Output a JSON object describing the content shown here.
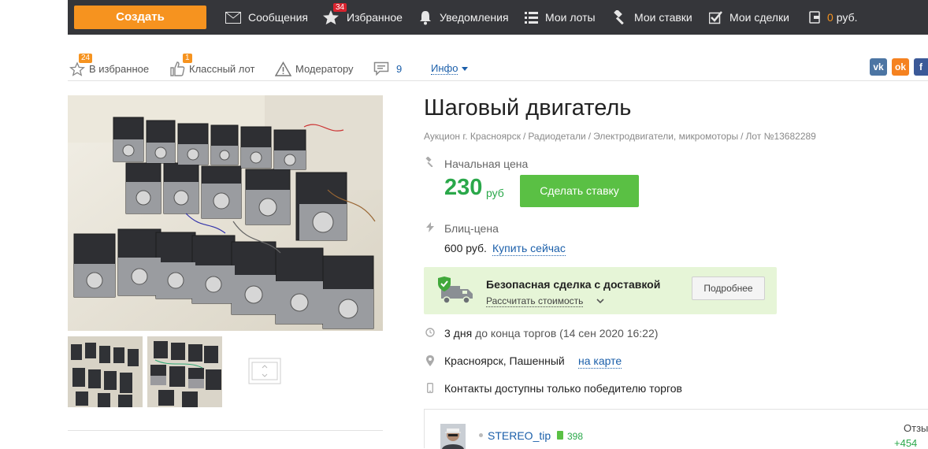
{
  "topbar": {
    "create_label": "Создать",
    "messages_label": "Сообщения",
    "favorites_label": "Избранное",
    "favorites_badge": "34",
    "notifications_label": "Уведомления",
    "my_lots_label": "Мои лоты",
    "my_bids_label": "Мои ставки",
    "my_deals_label": "Мои сделки",
    "balance_amount": "0",
    "balance_currency": "руб."
  },
  "actions": {
    "favorites_count": "24",
    "favorites_label": "В избранное",
    "like_count": "1",
    "like_label": "Классный лот",
    "moderator_label": "Модератору",
    "comments_count": "9",
    "info_label": "Инфо"
  },
  "share": {
    "vk": "vk",
    "ok": "ok",
    "fb": "f"
  },
  "lot": {
    "title": "Шаговый двигатель",
    "breadcrumbs": [
      "Аукцион г. Красноярск",
      "Радиодетали",
      "Электродвигатели, микромоторы",
      "Лот №13682289"
    ],
    "breadcrumb_sep": "/",
    "start_price_label": "Начальная цена",
    "start_price": "230",
    "currency": "руб",
    "bid_button": "Сделать ставку",
    "blitz_label": "Блиц-цена",
    "blitz_price": "600 руб.",
    "buy_now": "Купить сейчас",
    "safe_deal_title": "Безопасная сделка с доставкой",
    "safe_deal_calc": "Рассчитать стоимость",
    "safe_deal_more": "Подробнее",
    "time_left": "3 дня",
    "time_left_suffix": "до конца торгов",
    "end_date": "(14 сен 2020 16:22)",
    "location": "Красноярск, Пашенный",
    "map_link": "на карте",
    "contacts": "Контакты доступны только победителю торгов"
  },
  "seller": {
    "name": "STEREO_tip",
    "rating": "398",
    "reviews_label": "Отзы",
    "reviews_count": "+454"
  },
  "colors": {
    "accent": "#f6931f",
    "topbar": "#35363a",
    "price_green": "#2aa84a",
    "bid_button": "#5ac044",
    "link": "#1b5faa",
    "safe_box": "#e6f5d7"
  }
}
